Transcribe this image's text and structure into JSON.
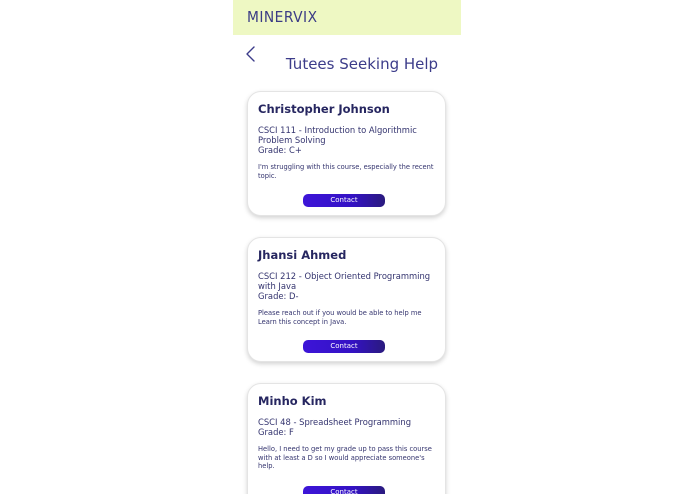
{
  "app": {
    "logo_text": "MINERVIX",
    "page_title": "Tutees Seeking Help"
  },
  "colors": {
    "topbar_bg": "#eef8c3",
    "title_color": "#3c3c8a",
    "button_gradient_start": "#3d15d8",
    "button_gradient_end": "#2a1a7e"
  },
  "icons": {
    "back": "chevron-left-icon"
  },
  "tutees": [
    {
      "name": "Christopher Johnson",
      "course": "CSCI 111 - Introduction to Algorithmic Problem Solving",
      "grade": "Grade: C+",
      "message": "I'm struggling with this course, especially the recent topic.",
      "contact_label": "Contact"
    },
    {
      "name": "Jhansi Ahmed",
      "course": "CSCI 212 - Object Oriented Programming with Java",
      "grade": "Grade: D-",
      "message": "Please reach out if you would be able to help me Learn this concept in Java.",
      "contact_label": "Contact"
    },
    {
      "name": "Minho Kim",
      "course": "CSCI 48 - Spreadsheet Programming",
      "grade": "Grade: F",
      "message": "Hello, I need to get my grade up to pass this course with at least a D so I would appreciate someone's help.",
      "contact_label": "Contact"
    }
  ]
}
